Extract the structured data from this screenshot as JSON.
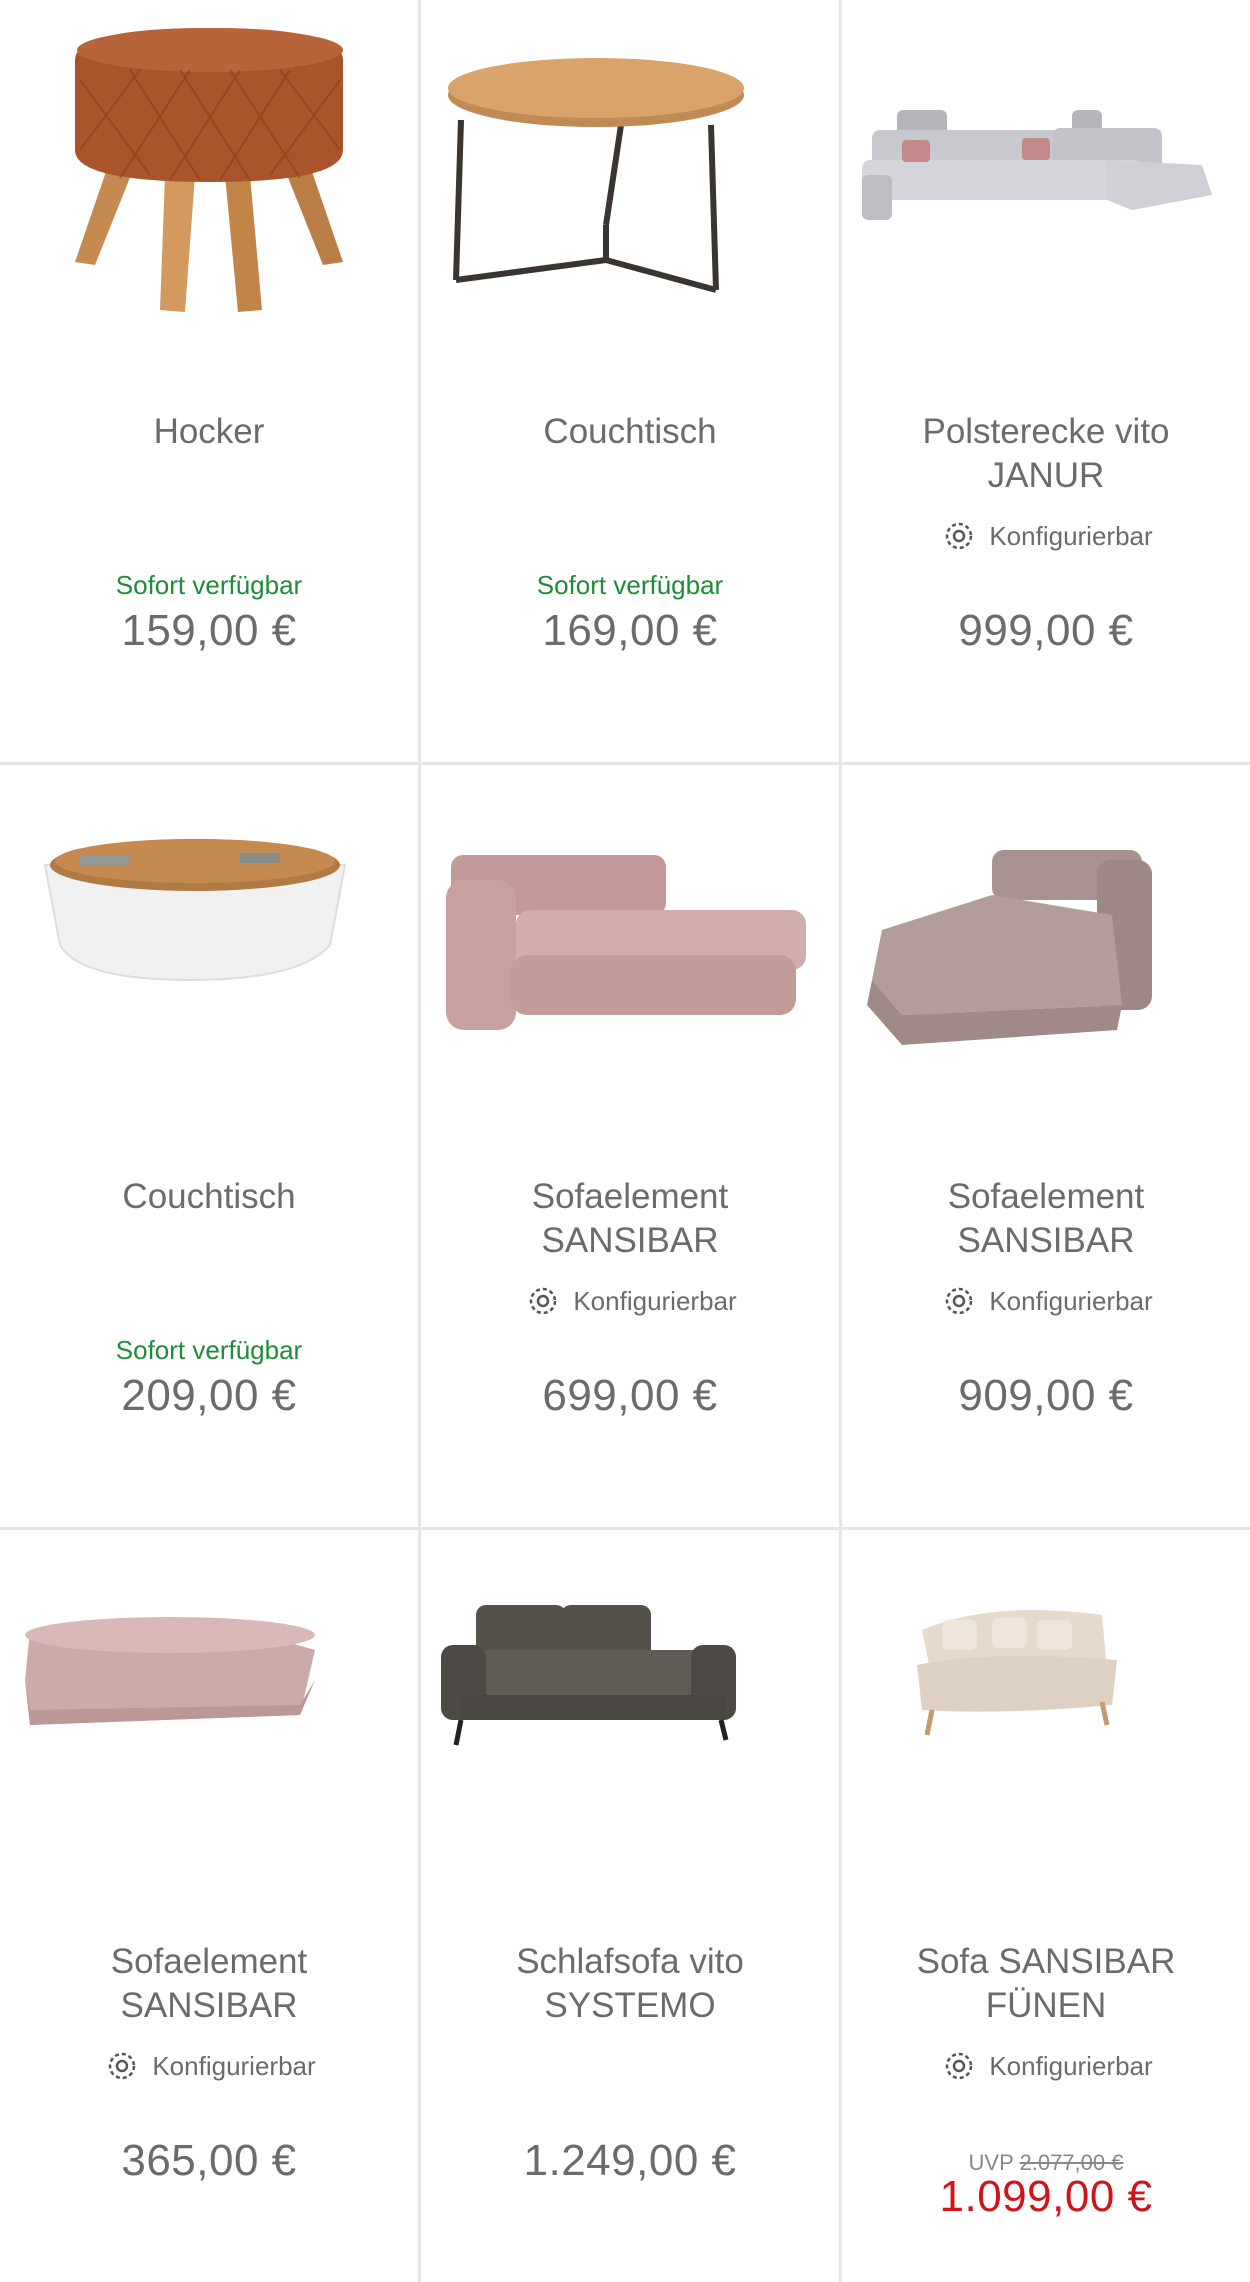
{
  "products": [
    {
      "name": "Hocker",
      "availability": "Sofort verfügbar",
      "price": "159,00 €"
    },
    {
      "name": "Couchtisch",
      "availability": "Sofort verfügbar",
      "price": "169,00 €"
    },
    {
      "name": "Polsterecke vito JANUR",
      "configurable_label": "Konfigurierbar",
      "price": "999,00 €"
    },
    {
      "name": "Couchtisch",
      "availability": "Sofort verfügbar",
      "price": "209,00 €"
    },
    {
      "name": "Sofaelement SANSIBAR",
      "configurable_label": "Konfigurierbar",
      "price": "699,00 €"
    },
    {
      "name": "Sofaelement SANSIBAR",
      "configurable_label": "Konfigurierbar",
      "price": "909,00 €"
    },
    {
      "name": "Sofaelement SANSIBAR",
      "configurable_label": "Konfigurierbar",
      "price": "365,00 €"
    },
    {
      "name": "Schlafsofa vito SYSTEMO",
      "price": "1.249,00 €"
    },
    {
      "name": "Sofa SANSIBAR FÜNEN",
      "configurable_label": "Konfigurierbar",
      "uvp_label": "UVP",
      "uvp_price": "2.077,00 €",
      "price": "1.099,00 €"
    }
  ],
  "icons": {
    "configurable": "gear-icon"
  },
  "colors": {
    "availability": "#1e8c3a",
    "sale_price": "#d0141b",
    "text": "#6b6b6b",
    "divider": "#e6e6e6"
  }
}
